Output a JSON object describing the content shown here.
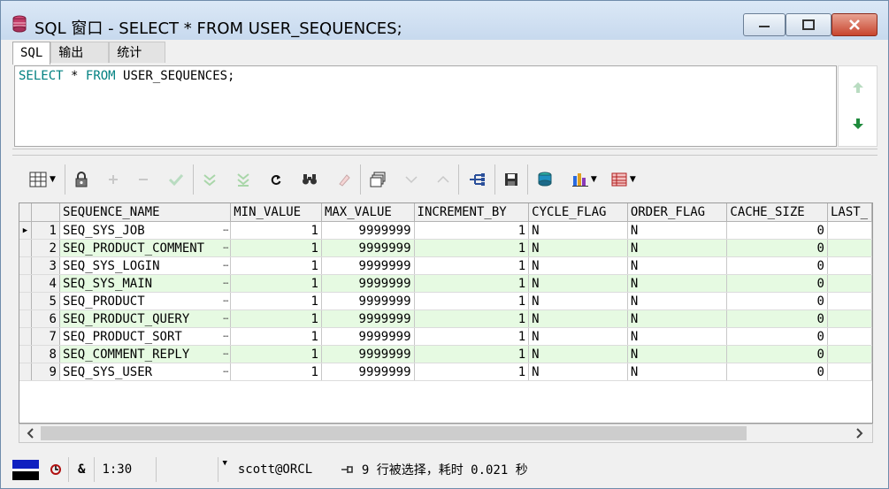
{
  "window": {
    "title": "SQL 窗口 - SELECT * FROM USER_SEQUENCES;"
  },
  "tabs": [
    {
      "label": "SQL",
      "active": true
    },
    {
      "label": "输出",
      "active": false
    },
    {
      "label": "统计",
      "active": false
    }
  ],
  "editor": {
    "kw_select": "SELECT",
    "star": "*",
    "kw_from": "FROM",
    "table_text": "USER_SEQUENCES;"
  },
  "toolbar": {
    "icons": [
      "grid-view-icon",
      "lock-icon",
      "add-record-icon",
      "delete-record-icon",
      "post-changes-icon",
      "fetch-next-page-icon",
      "fetch-last-page-icon",
      "refresh-icon",
      "find-icon",
      "clear-icon",
      "export-icon",
      "next-record-icon",
      "previous-record-icon",
      "query-plan-icon",
      "save-icon",
      "load-icon",
      "chart-icon",
      "single-record-view-icon"
    ]
  },
  "grid": {
    "columns": [
      "SEQUENCE_NAME",
      "MIN_VALUE",
      "MAX_VALUE",
      "INCREMENT_BY",
      "CYCLE_FLAG",
      "ORDER_FLAG",
      "CACHE_SIZE",
      "LAST_"
    ],
    "rows": [
      {
        "n": "1",
        "name": "SEQ_SYS_JOB",
        "min": "1",
        "max": "9999999",
        "inc": "1",
        "cycle": "N",
        "order": "N",
        "cache": "0"
      },
      {
        "n": "2",
        "name": "SEQ_PRODUCT_COMMENT",
        "min": "1",
        "max": "9999999",
        "inc": "1",
        "cycle": "N",
        "order": "N",
        "cache": "0"
      },
      {
        "n": "3",
        "name": "SEQ_SYS_LOGIN",
        "min": "1",
        "max": "9999999",
        "inc": "1",
        "cycle": "N",
        "order": "N",
        "cache": "0"
      },
      {
        "n": "4",
        "name": "SEQ_SYS_MAIN",
        "min": "1",
        "max": "9999999",
        "inc": "1",
        "cycle": "N",
        "order": "N",
        "cache": "0"
      },
      {
        "n": "5",
        "name": "SEQ_PRODUCT",
        "min": "1",
        "max": "9999999",
        "inc": "1",
        "cycle": "N",
        "order": "N",
        "cache": "0"
      },
      {
        "n": "6",
        "name": "SEQ_PRODUCT_QUERY",
        "min": "1",
        "max": "9999999",
        "inc": "1",
        "cycle": "N",
        "order": "N",
        "cache": "0"
      },
      {
        "n": "7",
        "name": "SEQ_PRODUCT_SORT",
        "min": "1",
        "max": "9999999",
        "inc": "1",
        "cycle": "N",
        "order": "N",
        "cache": "0"
      },
      {
        "n": "8",
        "name": "SEQ_COMMENT_REPLY",
        "min": "1",
        "max": "9999999",
        "inc": "1",
        "cycle": "N",
        "order": "N",
        "cache": "0"
      },
      {
        "n": "9",
        "name": "SEQ_SYS_USER",
        "min": "1",
        "max": "9999999",
        "inc": "1",
        "cycle": "N",
        "order": "N",
        "cache": "0"
      }
    ],
    "alt_row_color": "#e6fae2"
  },
  "status": {
    "amp": "&",
    "cursor_pos": "1:30",
    "connection": "scott@ORCL",
    "message": "9 行被选择，耗时 0.021 秒"
  },
  "colors": {
    "keyword": "#008080",
    "close_button": "#c8452e",
    "title_bar": "#c7d9ee"
  }
}
